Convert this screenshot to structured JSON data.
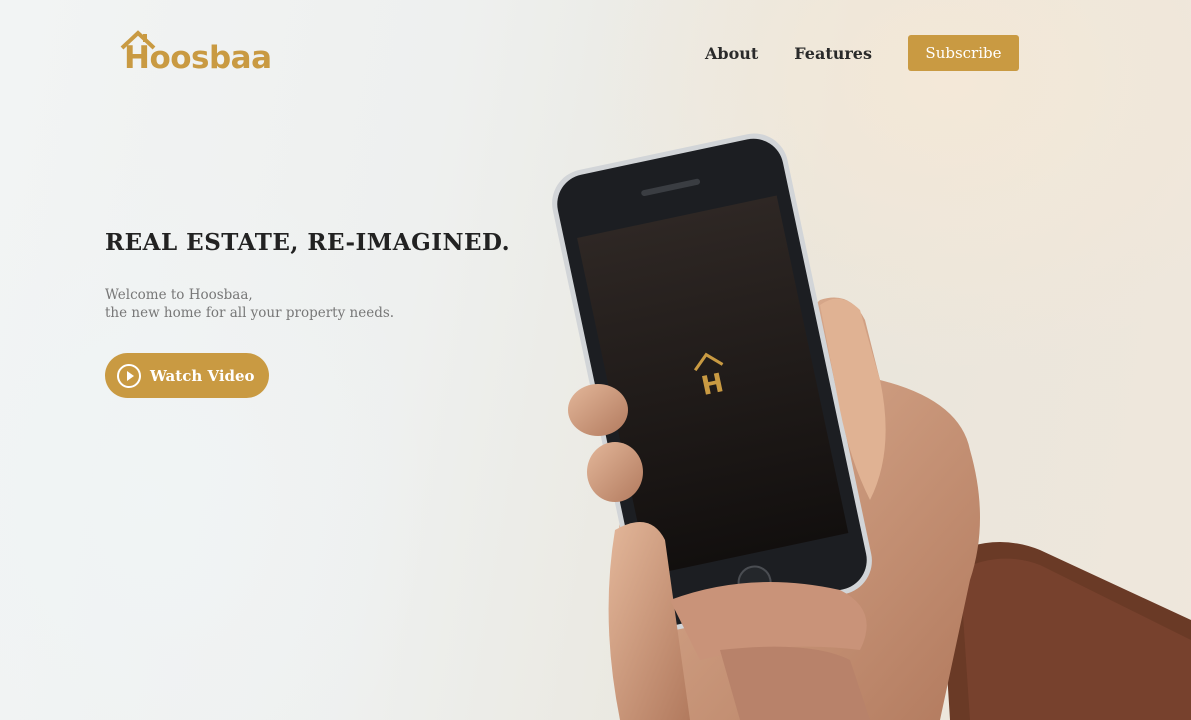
{
  "brand": {
    "name": "Hoosbaa",
    "accent": "#c99a42"
  },
  "nav": {
    "links": [
      {
        "label": "About"
      },
      {
        "label": "Features"
      }
    ],
    "subscribe_label": "Subscribe"
  },
  "hero": {
    "headline": "REAL ESTATE, RE-IMAGINED.",
    "subtitle_line1": "Welcome to Hoosbaa,",
    "subtitle_line2": "the new home for all your property needs.",
    "cta_label": "Watch Video",
    "cta_icon": "play-circle-icon"
  },
  "illustration": {
    "phone_logo_letter": "H"
  }
}
